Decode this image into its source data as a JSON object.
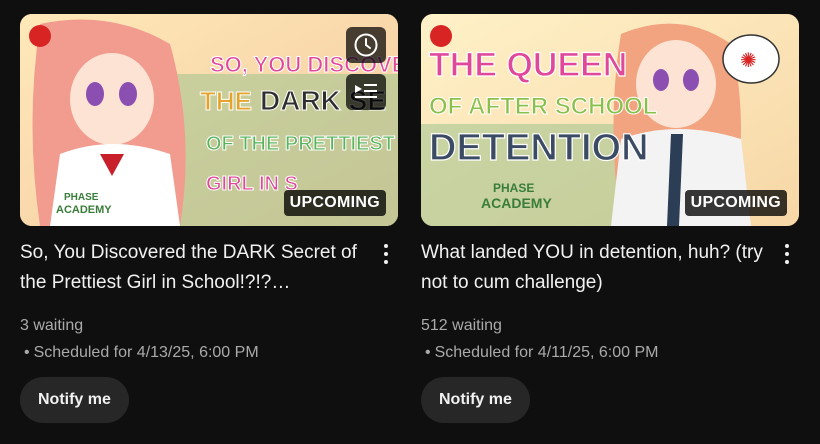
{
  "videos": [
    {
      "thumb_text": [
        "SO, YOU DISCOVE",
        "DARK SE",
        "THE",
        "OF THE PRETTIEST",
        "GIRL IN S"
      ],
      "brand": [
        "PHASE",
        "ACADEMY"
      ],
      "badge": "UPCOMING",
      "title": "So, You Discovered the DARK Secret of the Prettiest Girl in School!?!?…",
      "waiting": "3 waiting",
      "scheduled": "Scheduled for 4/13/25, 6:00 PM",
      "bullet": "•",
      "notify": "Notify me",
      "hover_icons": [
        "clock-icon",
        "add-to-queue-icon"
      ]
    },
    {
      "thumb_text": [
        "THE QUEEN",
        "OF AFTER SCHOOL",
        "DETENTION"
      ],
      "brand": [
        "PHASE",
        "ACADEMY"
      ],
      "badge": "UPCOMING",
      "title": "What landed YOU in detention, huh? (try not to cum challenge)",
      "waiting": "512 waiting",
      "scheduled": "Scheduled for 4/11/25, 6:00 PM",
      "bullet": "•",
      "notify": "Notify me"
    }
  ],
  "colors": {
    "background": "#0f0f0f",
    "text": "#f1f1f1",
    "secondary": "#aaaaaa",
    "button": "#272727"
  }
}
